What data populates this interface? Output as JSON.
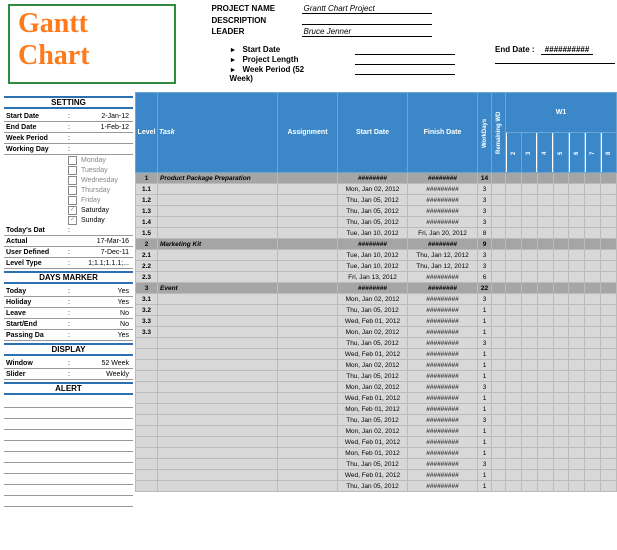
{
  "logo": "Gantt Chart",
  "meta": {
    "projectNameLbl": "PROJECT NAME",
    "projectNameVal": "Grantt Chart Project",
    "descLbl": "DESCRIPTION",
    "leaderLbl": "LEADER",
    "leaderVal": "Bruce Jenner",
    "bullets": [
      "Start Date",
      "Project Length",
      "Week Period (52 Week)"
    ],
    "endDateLbl": "End Date :",
    "endDateVal": "##########"
  },
  "settings": {
    "hdr": "SETTING",
    "startDate": {
      "k": "Start Date",
      "v": "2-Jan-12"
    },
    "endDate": {
      "k": "End Date",
      "v": "1-Feb-12"
    },
    "weekPeriod": {
      "k": "Week Period",
      "v": ""
    },
    "workingDay": {
      "k": "Working Day",
      "v": ""
    },
    "days": [
      {
        "name": "Monday",
        "on": false,
        "g": true
      },
      {
        "name": "Tuesday",
        "on": false,
        "g": true
      },
      {
        "name": "Wednesday",
        "on": false,
        "g": true
      },
      {
        "name": "Thursday",
        "on": false,
        "g": true
      },
      {
        "name": "Friday",
        "on": false,
        "g": true
      },
      {
        "name": "Saturday",
        "on": true,
        "g": false
      },
      {
        "name": "Sunday",
        "on": true,
        "g": false
      }
    ],
    "todaysDate": {
      "k": "Today's Dat",
      "v": ""
    },
    "actual": {
      "k": "Actual",
      "v": "17-Mar-16"
    },
    "userDefined": {
      "k": "User Defined",
      "v": "7-Dec-11"
    },
    "levelType": {
      "k": "Level Type",
      "v": "1;1.1;1.1.1;..."
    }
  },
  "daysMarker": {
    "hdr": "DAYS MARKER",
    "today": {
      "k": "Today",
      "v": "Yes"
    },
    "holiday": {
      "k": "Holiday",
      "v": "Yes"
    },
    "leave": {
      "k": "Leave",
      "v": "No"
    },
    "startEnd": {
      "k": "Start/End",
      "v": "No"
    },
    "passingDay": {
      "k": "Passing Da",
      "v": "Yes"
    }
  },
  "display": {
    "hdr": "DISPLAY",
    "window": {
      "k": "Window",
      "v": "52 Week"
    },
    "slider": {
      "k": "Slider",
      "v": "Weekly"
    }
  },
  "alert": {
    "hdr": "ALERT"
  },
  "grid": {
    "headers": {
      "level": "Level",
      "task": "Task",
      "assignment": "Assignment",
      "startDate": "Start Date",
      "finishDate": "Finish Date",
      "workDays": "WorkDays",
      "remaining": "Remaining WD",
      "w1": "W1"
    },
    "weekDays": [
      "2",
      "3",
      "4",
      "5",
      "6",
      "7",
      "8"
    ],
    "rows": [
      {
        "lvl": "1",
        "task": "Product Package Preparation",
        "start": "########",
        "finish": "########",
        "wd": "14",
        "rw": "",
        "sect": true,
        "bars": [
          0,
          1,
          2,
          3,
          4,
          5,
          6
        ]
      },
      {
        "lvl": "1.1",
        "task": "",
        "start": "Mon, Jan 02, 2012",
        "finish": "#########",
        "wd": "3",
        "rw": "",
        "bars": [
          0,
          1,
          2
        ]
      },
      {
        "lvl": "1.2",
        "task": "",
        "start": "Thu, Jan 05, 2012",
        "finish": "#########",
        "wd": "3",
        "rw": "",
        "bars": [
          3,
          4,
          5
        ]
      },
      {
        "lvl": "1.3",
        "task": "",
        "start": "Thu, Jan 05, 2012",
        "finish": "#########",
        "wd": "3",
        "rw": "",
        "bars": [
          3,
          4,
          5
        ]
      },
      {
        "lvl": "1.4",
        "task": "",
        "start": "Thu, Jan 05, 2012",
        "finish": "#########",
        "wd": "3",
        "rw": "",
        "bars": [
          3,
          4,
          5
        ]
      },
      {
        "lvl": "1.5",
        "task": "",
        "start": "Tue, Jan 10, 2012",
        "finish": "Fri, Jan 20, 2012",
        "wd": "8",
        "rw": "",
        "bars": []
      },
      {
        "lvl": "2",
        "task": "Marketing Kit",
        "start": "########",
        "finish": "########",
        "wd": "9",
        "rw": "",
        "sect": true,
        "bars": []
      },
      {
        "lvl": "2.1",
        "task": "",
        "start": "Tue, Jan 10, 2012",
        "finish": "Thu, Jan 12, 2012",
        "wd": "3",
        "rw": "",
        "bars": []
      },
      {
        "lvl": "2.2",
        "task": "",
        "start": "Tue, Jan 10, 2012",
        "finish": "Thu, Jan 12, 2012",
        "wd": "3",
        "rw": "",
        "bars": []
      },
      {
        "lvl": "2.3",
        "task": "",
        "start": "Fri, Jan 13, 2012",
        "finish": "#########",
        "wd": "6",
        "rw": "",
        "bars": []
      },
      {
        "lvl": "3",
        "task": "Event",
        "start": "########",
        "finish": "########",
        "wd": "22",
        "rw": "",
        "sect": true,
        "bars": [
          0,
          1,
          2,
          3,
          4,
          5,
          6
        ]
      },
      {
        "lvl": "3.1",
        "task": "",
        "start": "Mon, Jan 02, 2012",
        "finish": "#########",
        "wd": "3",
        "rw": "",
        "bars": [
          0,
          1,
          2
        ]
      },
      {
        "lvl": "3.2",
        "task": "",
        "start": "Thu, Jan 05, 2012",
        "finish": "#########",
        "wd": "1",
        "rw": "",
        "bars": [
          3
        ]
      },
      {
        "lvl": "3.3",
        "task": "",
        "start": "Wed, Feb 01, 2012",
        "finish": "#########",
        "wd": "1",
        "rw": "",
        "bars": []
      },
      {
        "lvl": "3.3",
        "task": "",
        "start": "Mon, Jan 02, 2012",
        "finish": "#########",
        "wd": "1",
        "rw": "",
        "bars": [
          0
        ]
      },
      {
        "lvl": "",
        "task": "",
        "start": "Thu, Jan 05, 2012",
        "finish": "#########",
        "wd": "3",
        "rw": "",
        "bars": [
          3,
          4,
          5
        ]
      },
      {
        "lvl": "",
        "task": "",
        "start": "Wed, Feb 01, 2012",
        "finish": "#########",
        "wd": "1",
        "rw": "",
        "bars": []
      },
      {
        "lvl": "",
        "task": "",
        "start": "Mon, Jan 02, 2012",
        "finish": "#########",
        "wd": "1",
        "rw": "",
        "bars": [
          0
        ]
      },
      {
        "lvl": "",
        "task": "",
        "start": "Thu, Jan 05, 2012",
        "finish": "#########",
        "wd": "1",
        "rw": "",
        "bars": [
          3
        ]
      },
      {
        "lvl": "",
        "task": "",
        "start": "Mon, Jan 02, 2012",
        "finish": "#########",
        "wd": "3",
        "rw": "",
        "bars": [
          0,
          1,
          2
        ]
      },
      {
        "lvl": "",
        "task": "",
        "start": "Wed, Feb 01, 2012",
        "finish": "#########",
        "wd": "1",
        "rw": "",
        "bars": []
      },
      {
        "lvl": "",
        "task": "",
        "start": "Mon, Feb 01, 2012",
        "finish": "#########",
        "wd": "1",
        "rw": "",
        "bars": []
      },
      {
        "lvl": "",
        "task": "",
        "start": "Thu, Jan 05, 2012",
        "finish": "#########",
        "wd": "3",
        "rw": "",
        "bars": [
          3,
          4,
          5
        ]
      },
      {
        "lvl": "",
        "task": "",
        "start": "Mon, Jan 02, 2012",
        "finish": "#########",
        "wd": "1",
        "rw": "",
        "bars": [
          0
        ]
      },
      {
        "lvl": "",
        "task": "",
        "start": "Wed, Feb 01, 2012",
        "finish": "#########",
        "wd": "1",
        "rw": "",
        "bars": []
      },
      {
        "lvl": "",
        "task": "",
        "start": "Mon, Feb 01, 2012",
        "finish": "#########",
        "wd": "1",
        "rw": "",
        "bars": []
      },
      {
        "lvl": "",
        "task": "",
        "start": "Thu, Jan 05, 2012",
        "finish": "#########",
        "wd": "3",
        "rw": "",
        "bars": [
          3,
          4,
          5
        ]
      },
      {
        "lvl": "",
        "task": "",
        "start": "Wed, Feb 01, 2012",
        "finish": "#########",
        "wd": "1",
        "rw": "",
        "bars": []
      },
      {
        "lvl": "",
        "task": "",
        "start": "Thu, Jan 05, 2012",
        "finish": "#########",
        "wd": "1",
        "rw": "",
        "bars": [
          3
        ]
      }
    ]
  }
}
